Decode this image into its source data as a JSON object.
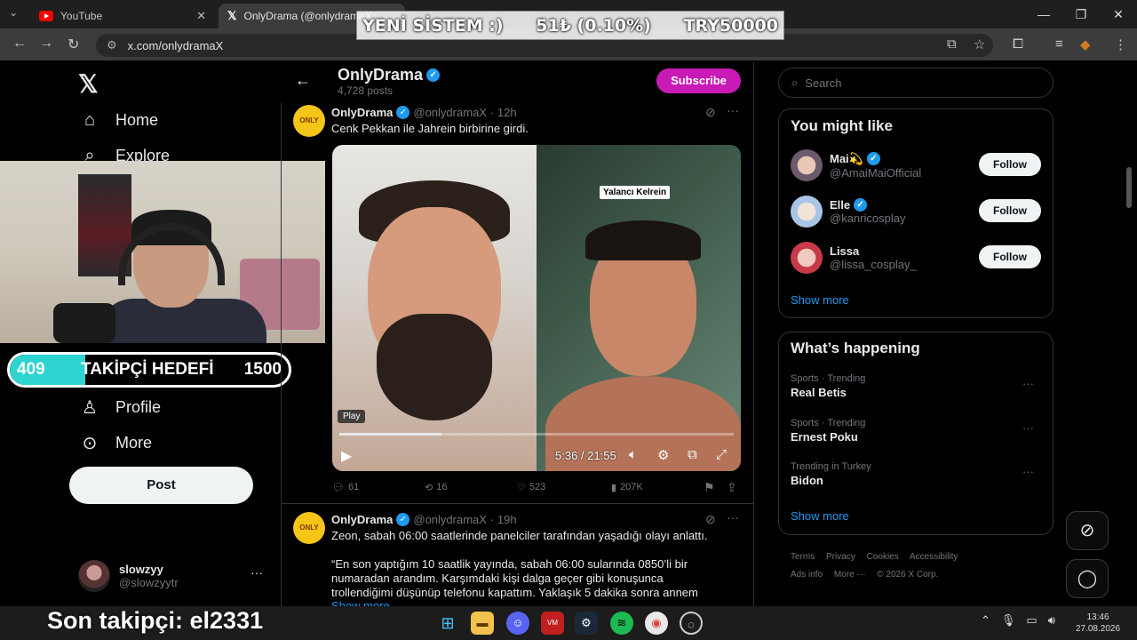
{
  "browser": {
    "tabs": [
      {
        "title": "YouTube",
        "icon": "youtube-icon"
      },
      {
        "title": "OnlyDrama (@onlydramaX",
        "icon": "x-icon"
      }
    ],
    "url": "x.com/onlydramaX"
  },
  "overlay": {
    "donation_title": "YENİ SİSTEM :)",
    "donation_amount": "51₺ (0.10%)",
    "donation_goal": "TRY50000",
    "follower_goal": {
      "current": "409",
      "label": "TAKİPÇİ HEDEFİ",
      "target": "1500",
      "progress_fraction": 0.27
    },
    "last_follower": "Son takipçi: el2331"
  },
  "sidebar": {
    "items": [
      {
        "label": "Home",
        "icon": "home-icon"
      },
      {
        "label": "Explore",
        "icon": "search-icon"
      },
      {
        "label": "Profile",
        "icon": "person-icon"
      },
      {
        "label": "More",
        "icon": "more-circle-icon"
      }
    ],
    "post_label": "Post",
    "account": {
      "name": "slowzyy",
      "handle": "@slowzyytr"
    }
  },
  "profile_header": {
    "name": "OnlyDrama",
    "posts": "4,728 posts",
    "subscribe_label": "Subscribe"
  },
  "tweets": [
    {
      "name": "OnlyDrama",
      "handle": "@onlydramaX",
      "time": "· 12h",
      "text": "Cenk Pekkan ile Jahrein birbirine girdi.",
      "video": {
        "label": "Yalancı Kelrein",
        "play_tip": "Play",
        "time": "5:36 / 21:55",
        "progress_fraction": 0.26
      },
      "replies": "61",
      "reposts": "16",
      "likes": "523",
      "views": "207K"
    },
    {
      "name": "OnlyDrama",
      "handle": "@onlydramaX",
      "time": "· 19h",
      "text": "Zeon, sabah 06:00 saatlerinde panelciler tarafından yaşadığı olayı anlattı.",
      "quote_line1": "“En son yaptığım 10 saatlik yayında, sabah 06:00 sularında 0850’li bir",
      "quote_line2": "numaradan arandım. Karşımdaki kişi dalga geçer gibi konuşunca",
      "quote_line3": "trollendiğimi düşünüp telefonu kapattım. Yaklaşık 5 dakika sonra annem",
      "show_more": "Show more"
    }
  ],
  "right": {
    "search_placeholder": "Search",
    "you_might_like": {
      "title": "You might like",
      "users": [
        {
          "name": "Mai💫",
          "handle": "@AmaiMaiOfficial",
          "verified": true
        },
        {
          "name": "Elle",
          "handle": "@kanricosplay",
          "verified": true
        },
        {
          "name": "Lissa",
          "handle": "@lissa_cosplay_",
          "verified": false
        }
      ],
      "follow_label": "Follow",
      "show_more": "Show more"
    },
    "whats_happening": {
      "title": "What’s happening",
      "trends": [
        {
          "meta": "Sports · Trending",
          "title": "Real Betis"
        },
        {
          "meta": "Sports · Trending",
          "title": "Ernest Poku"
        },
        {
          "meta": "Trending in Turkey",
          "title": "Bidon"
        }
      ],
      "show_more": "Show more"
    },
    "footer": [
      "Terms",
      "Privacy",
      "Cookies",
      "Accessibility",
      "Ads info",
      "More ···",
      "© 2026 X Corp."
    ]
  },
  "taskbar": {
    "time": "13:46",
    "date": "27.08.2026"
  },
  "colors": {
    "accent": "#1d9bf0",
    "subscribe": "#c91ab5",
    "goal_fill": "#2dd4d0"
  }
}
